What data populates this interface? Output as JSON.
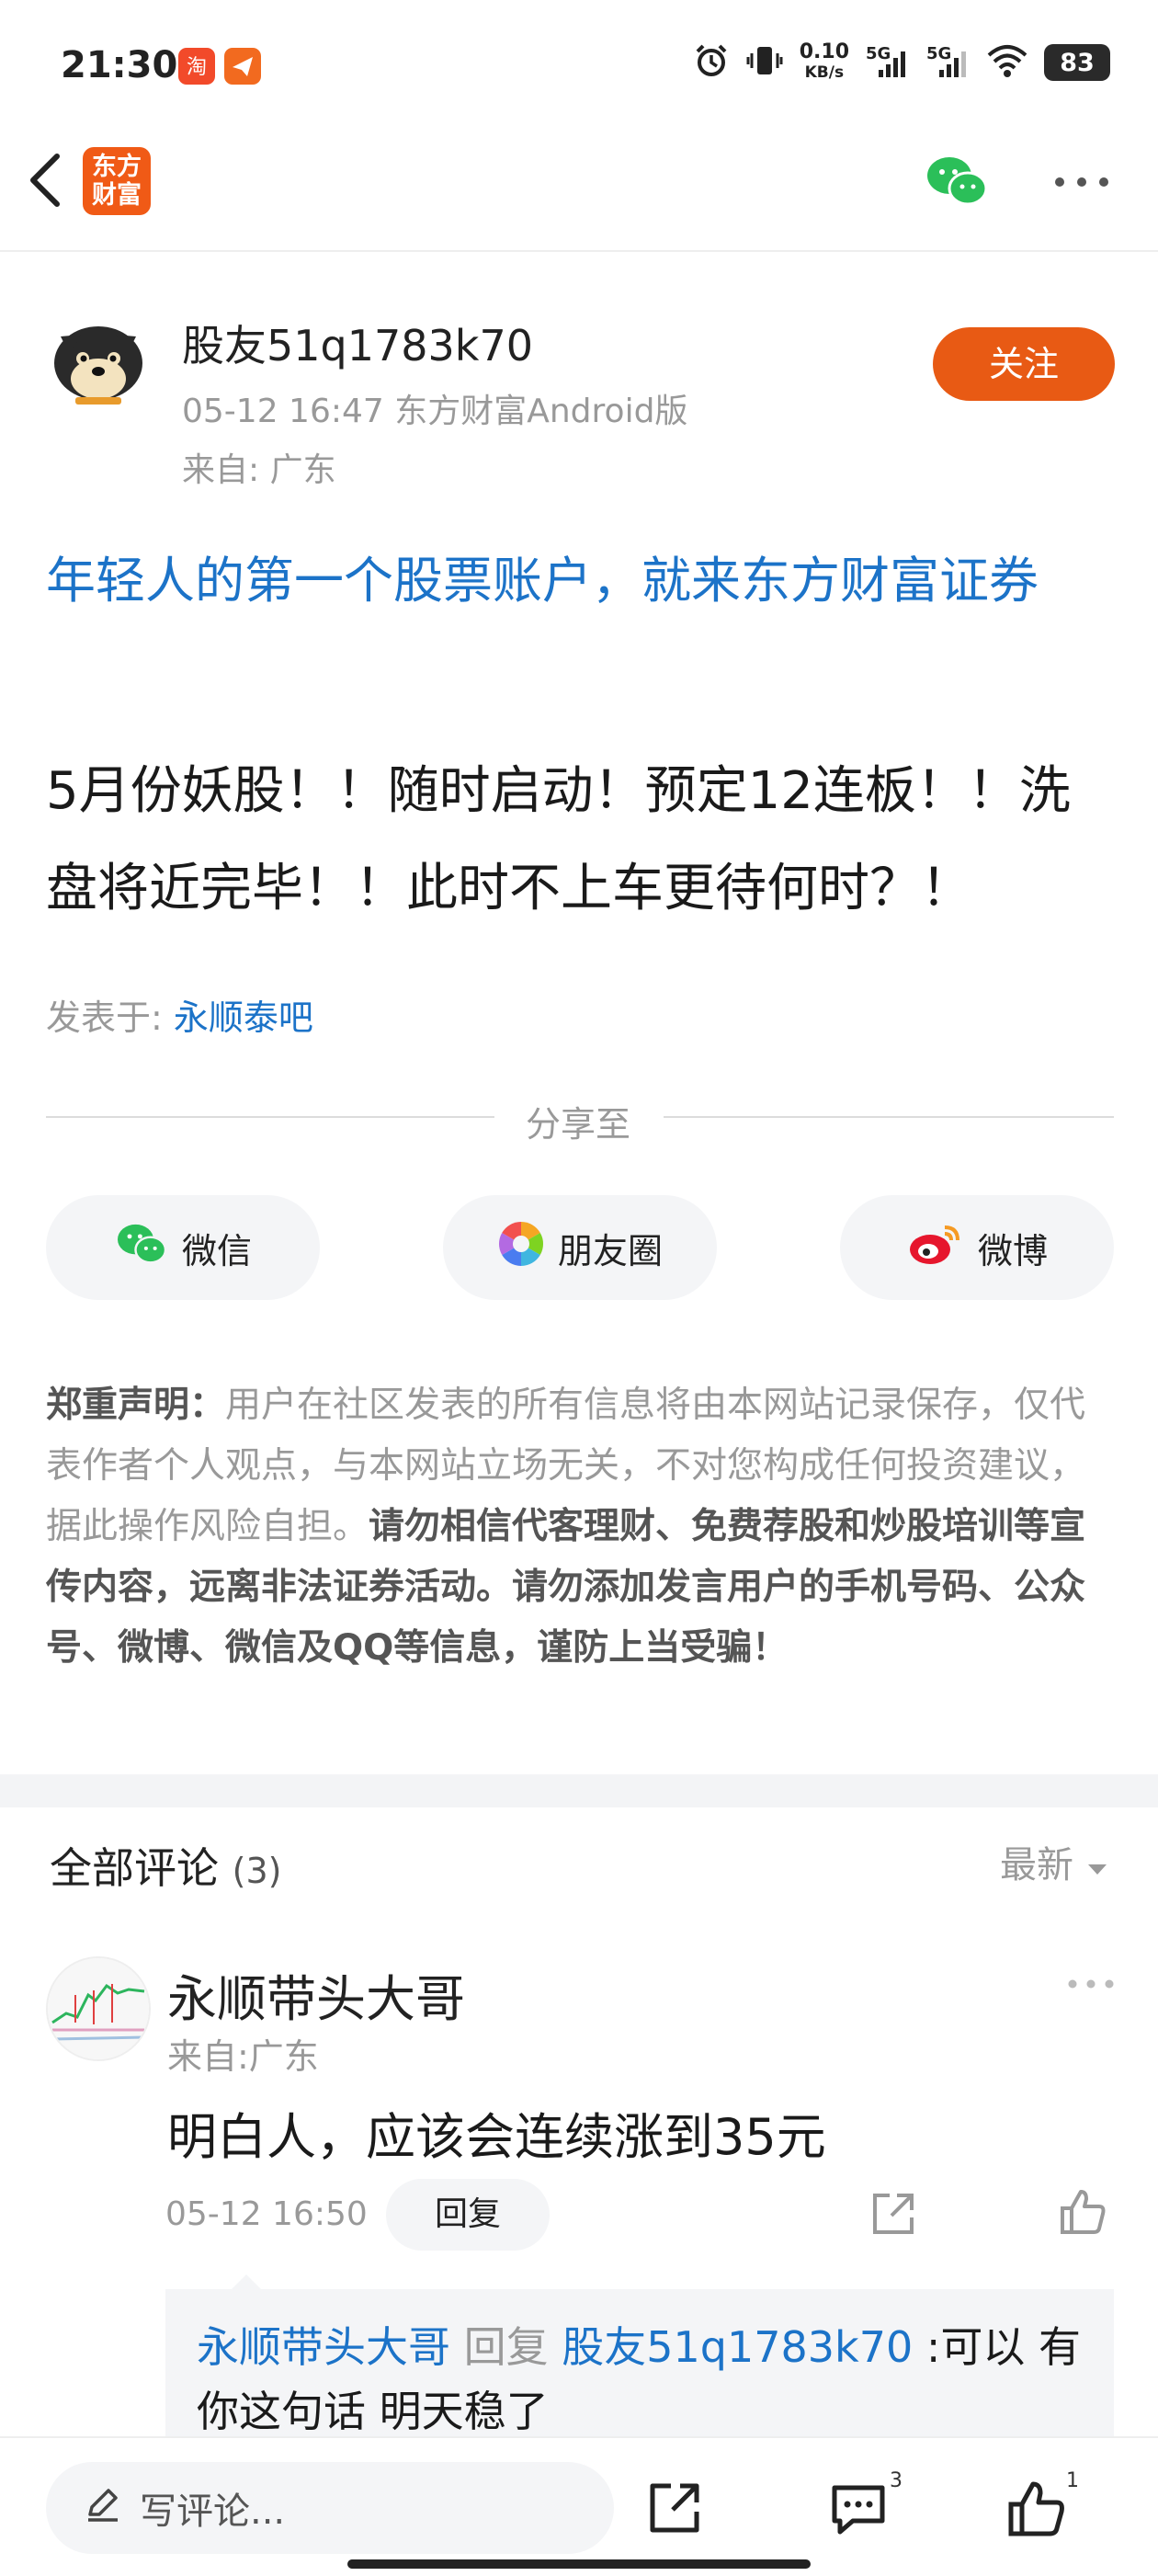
{
  "status_bar": {
    "time": "21:30",
    "net_speed_top": "0.10",
    "net_speed_bottom": "KB/s",
    "sim1": "5G",
    "sim2": "5G",
    "battery": "83"
  },
  "header": {
    "logo_line1": "东方",
    "logo_line2": "财富"
  },
  "post": {
    "author": "股友51q1783k70",
    "meta": "05-12 16:47 东方财富Android版",
    "location": "来自: 广东",
    "follow_label": "关注",
    "title": "年轻人的第一个股票账户，就来东方财富证券",
    "body": "5月份妖股！！随时启动！预定12连板！！洗盘将近完毕！！此时不上车更待何时？！",
    "posted_in_label": "发表于: ",
    "posted_in_bar": "永顺泰吧"
  },
  "share": {
    "title": "分享至",
    "wechat": "微信",
    "moments": "朋友圈",
    "weibo": "微博"
  },
  "disclaimer": {
    "label": "郑重声明：",
    "text1": "用户在社区发表的所有信息将由本网站记录保存，仅代表作者个人观点，与本网站立场无关，不对您构成任何投资建议，据此操作风险自担。",
    "text2": "请勿相信代客理财、免费荐股和炒股培训等宣传内容，远离非法证券活动。请勿添加发言用户的手机号码、公众号、微博、微信及QQ等信息，谨防上当受骗！"
  },
  "comments": {
    "title": "全部评论",
    "count": "(3)",
    "sort_label": "最新",
    "items": [
      {
        "name": "永顺带头大哥",
        "from": "来自:广东",
        "text": "明白人，应该会连续涨到35元",
        "time": "05-12 16:50",
        "reply_label": "回复",
        "reply": {
          "from": "永顺带头大哥",
          "verb": "回复",
          "to": "股友51q1783k70",
          "text": ":可以 有你这句话 明天稳了"
        }
      }
    ]
  },
  "bottom_bar": {
    "placeholder": "写评论...",
    "comment_count": "3",
    "like_count": "1"
  },
  "colors": {
    "accent_orange": "#e85a14",
    "link_blue": "#1c73c8",
    "muted": "#999999"
  }
}
